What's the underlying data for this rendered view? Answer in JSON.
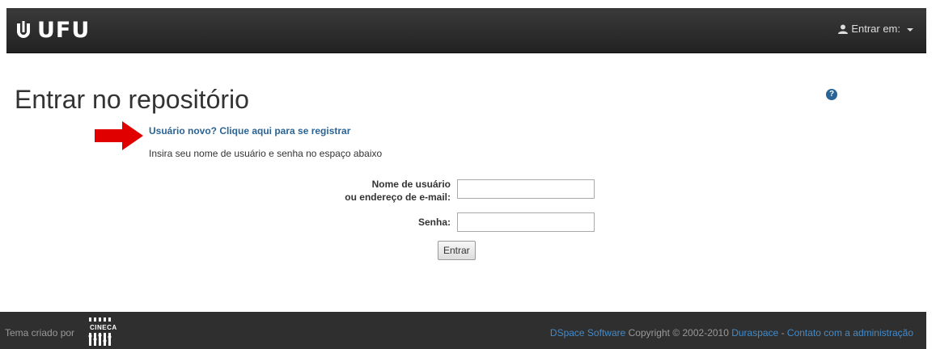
{
  "header": {
    "brand_text": "UFU",
    "login_menu_label": "Entrar em:",
    "logo_icon": "ufu-logo-icon",
    "user_icon": "user-icon",
    "caret_icon": "caret-down-icon"
  },
  "main": {
    "title": "Entrar no repositório",
    "help_icon_glyph": "?",
    "register_link": "Usuário novo? Clique aqui para se registrar",
    "instructions": "Insira seu nome de usuário e senha no espaço abaixo",
    "form": {
      "username_label_line1": "Nome de usuário",
      "username_label_line2": "ou endereço de e-mail:",
      "username_value": "",
      "password_label": "Senha:",
      "password_value": "",
      "submit_label": "Entrar"
    },
    "arrow_color": "#e00000"
  },
  "footer": {
    "theme_credit": "Tema criado por",
    "cineca_logo_text": "CINECA",
    "dspace_link": "DSpace Software",
    "copyright_text": " Copyright © 2002-2010 ",
    "duraspace_link": "Duraspace",
    "separator": " - ",
    "contact_link": "Contato com a administração"
  },
  "colors": {
    "navbar_bg": "#2b2b2b",
    "link": "#2a6496",
    "footer_link": "#428bca",
    "footer_bg": "#2f2f2f"
  }
}
